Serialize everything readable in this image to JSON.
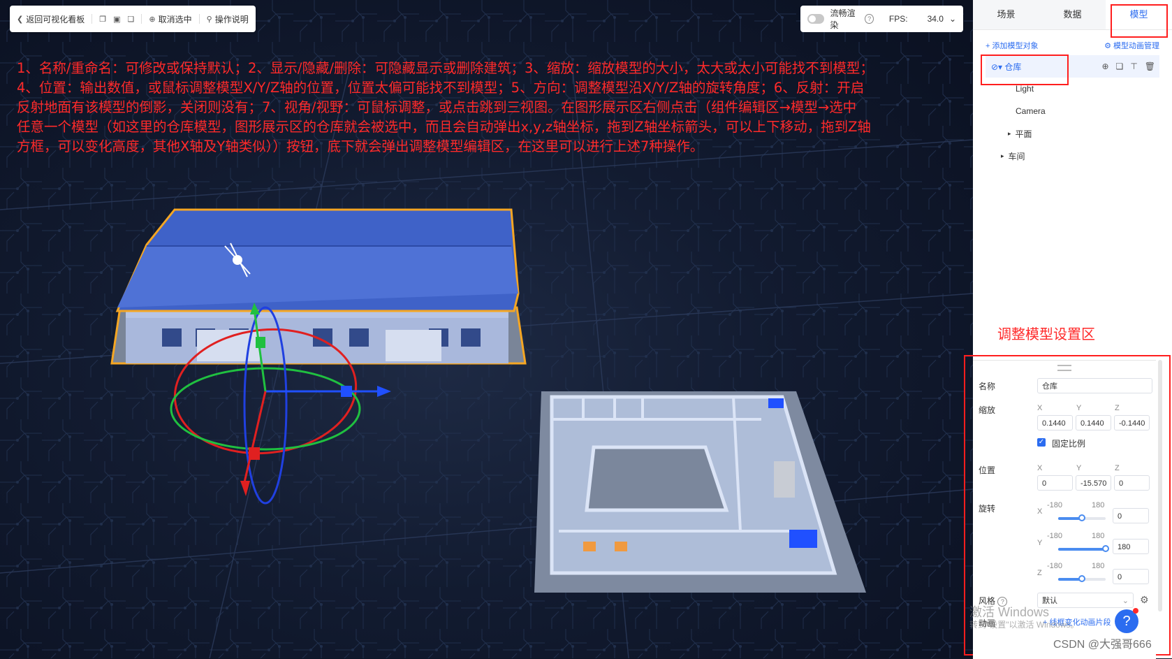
{
  "toolbar": {
    "back_label": "返回可视化看板",
    "deselect_label": "取消选中",
    "help_label": "操作说明"
  },
  "render_bar": {
    "smooth_label": "流畅渲染",
    "fps_label": "FPS:",
    "fps_value": "34.0"
  },
  "annotation_lines": [
    "1、名称/重命名：可修改或保持默认；2、显示/隐藏/删除：可隐藏显示或删除建筑；3、缩放：缩放模型的大小，太大或太小可能找不到模型；",
    "4、位置：输出数值，或鼠标调整模型X/Y/Z轴的位置，位置太偏可能找不到模型；5、方向：调整模型沿X/Y/Z轴的旋转角度；6、反射：开启",
    "反射地面有该模型的倒影，关闭则没有；7、视角/视野：可鼠标调整，或点击跳到三视图。在图形展示区右侧点击（组件编辑区→模型→选中",
    "任意一个模型（如这里的仓库模型，图形展示区的仓库就会被选中，而且会自动弹出x,y,z轴坐标，拖到Z轴坐标箭头，可以上下移动，拖到Z轴",
    "方框，可以变化高度，其他X轴及Y轴类似））按钮，底下就会弹出调整模型编辑区，在这里可以进行上述7种操作。"
  ],
  "tabs": [
    "场景",
    "数据",
    "模型"
  ],
  "actions": {
    "add_model": "+ 添加模型对象",
    "anim_manage": "模型动画管理"
  },
  "tree": {
    "selected": "仓库",
    "items": [
      "Light",
      "Camera",
      "平面",
      "车间"
    ]
  },
  "region_label": "调整模型设置区",
  "editor": {
    "name_label": "名称",
    "name_value": "仓库",
    "scale_label": "缩放",
    "axes": [
      "X",
      "Y",
      "Z"
    ],
    "scale_values": [
      "0.1440",
      "0.1440",
      "-0.1440"
    ],
    "lock_ratio_label": "固定比例",
    "position_label": "位置",
    "position_values": [
      "0",
      "-15.570",
      "0"
    ],
    "rotation_label": "旋转",
    "rot_min": "-180",
    "rot_max": "180",
    "rotations": [
      {
        "axis": "X",
        "value": "0",
        "fraction": 0.5
      },
      {
        "axis": "Y",
        "value": "180",
        "fraction": 1.0
      },
      {
        "axis": "Z",
        "value": "0",
        "fraction": 0.5
      }
    ],
    "style_label": "风格",
    "style_value": "默认",
    "anim_label": "动画",
    "anim_link": "+ 线框变化动画片段"
  },
  "overlays": {
    "win_activate": "激活 Windows",
    "win_activate_sub": "转到\"设置\"以激活 Windows。",
    "csdn": "CSDN @大强哥666",
    "help_fab": "?"
  },
  "colors": {
    "accent": "#2b6cf0",
    "annotation": "#ff2a2a",
    "roof": "#4a6fd0",
    "selection_outline": "#f5a623"
  }
}
